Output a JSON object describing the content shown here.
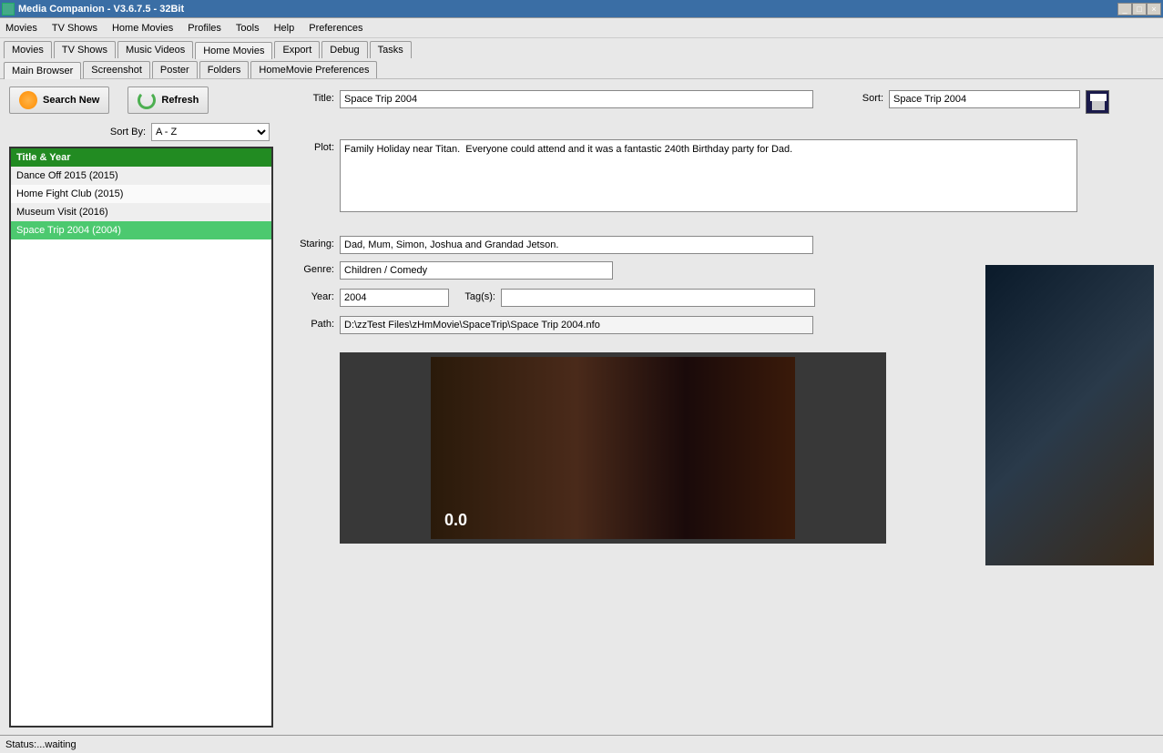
{
  "window": {
    "title": "Media Companion - V3.6.7.5 - 32Bit"
  },
  "menu": [
    "Movies",
    "TV Shows",
    "Home Movies",
    "Profiles",
    "Tools",
    "Help",
    "Preferences"
  ],
  "tabs": [
    "Movies",
    "TV Shows",
    "Music Videos",
    "Home Movies",
    "Export",
    "Debug",
    "Tasks"
  ],
  "tabs_active": 3,
  "subtabs": [
    "Main Browser",
    "Screenshot",
    "Poster",
    "Folders",
    "HomeMovie Preferences"
  ],
  "subtabs_active": 0,
  "buttons": {
    "search_new": "Search New",
    "refresh": "Refresh"
  },
  "sort": {
    "label": "Sort By:",
    "value": "A - Z"
  },
  "list": {
    "header": "Title & Year",
    "items": [
      "Dance Off 2015 (2015)",
      "Home Fight Club (2015)",
      "Museum Visit (2016)",
      "Space Trip 2004 (2004)"
    ],
    "selected": 3
  },
  "form": {
    "title_label": "Title:",
    "title": "Space Trip 2004",
    "sort_label": "Sort:",
    "sort": "Space Trip 2004",
    "plot_label": "Plot:",
    "plot": "Family Holiday near Titan.  Everyone could attend and it was a fantastic 240th Birthday party for Dad.",
    "staring_label": "Staring:",
    "staring": "Dad, Mum, Simon, Joshua and Grandad Jetson.",
    "genre_label": "Genre:",
    "genre": "Children / Comedy",
    "year_label": "Year:",
    "year": "2004",
    "tags_label": "Tag(s):",
    "tags": "",
    "path_label": "Path:",
    "path": "D:\\zzTest Files\\zHmMovie\\SpaceTrip\\Space Trip 2004.nfo"
  },
  "status": "Status:...waiting"
}
